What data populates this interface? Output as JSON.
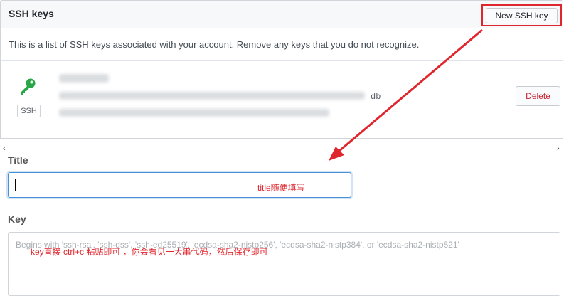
{
  "panel": {
    "title": "SSH keys",
    "new_key_button": "New SSH key",
    "intro": "This is a list of SSH keys associated with your account. Remove any keys that you do not recognize."
  },
  "key_entry": {
    "badge": "SSH",
    "fingerprint_tail": "db",
    "delete_button": "Delete"
  },
  "form": {
    "title_label": "Title",
    "title_value": "",
    "key_label": "Key",
    "key_placeholder": "Begins with 'ssh-rsa', 'ssh-dss', 'ssh-ed25519', 'ecdsa-sha2-nistp256', 'ecdsa-sha2-nistp384', or 'ecdsa-sha2-nistp521'"
  },
  "annotations": {
    "title_note": "title随便填写",
    "key_note": "key直接 ctrl+c 粘贴即可 ，你会看见一大串代码，然后保存即可",
    "color": "#e0262d"
  },
  "colors": {
    "accent_red": "#e0262d",
    "key_icon": "#28a745",
    "delete_text": "#cb2431",
    "focus_border": "#4a90d9"
  }
}
